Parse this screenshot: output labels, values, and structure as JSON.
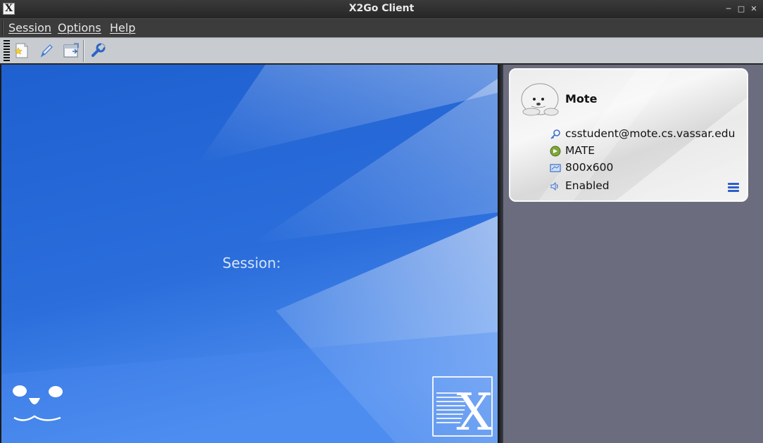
{
  "window": {
    "title": "X2Go Client",
    "app_icon_glyph": "X",
    "controls": [
      "minimize",
      "maximize",
      "close"
    ]
  },
  "menubar": {
    "items": [
      {
        "label": "Session"
      },
      {
        "label": "Options"
      },
      {
        "label": "Help"
      }
    ]
  },
  "toolbar": {
    "buttons": [
      {
        "icon": "new-session-icon"
      },
      {
        "icon": "edit-pencil-icon"
      },
      {
        "icon": "session-export-icon"
      },
      {
        "icon": "wrench-icon"
      }
    ]
  },
  "main": {
    "session_label": "Session:",
    "logo_glyph": "X"
  },
  "session_card": {
    "name": "Mote",
    "avatar_icon": "seal-avatar-icon",
    "rows": [
      {
        "icon": "key-icon",
        "text": "csstudent@mote.cs.vassar.edu"
      },
      {
        "icon": "mate-desktop-icon",
        "text": "MATE"
      },
      {
        "icon": "display-resolution-icon",
        "text": "800x600"
      },
      {
        "icon": "sound-icon",
        "text": "Enabled"
      }
    ],
    "menu_icon": "hamburger-menu-icon"
  },
  "colors": {
    "left_panel_blue": "#2a6bd8",
    "right_panel_bg": "#6b6d7e",
    "card_bg": "#efefef",
    "accent_blue": "#2d5fc9"
  }
}
